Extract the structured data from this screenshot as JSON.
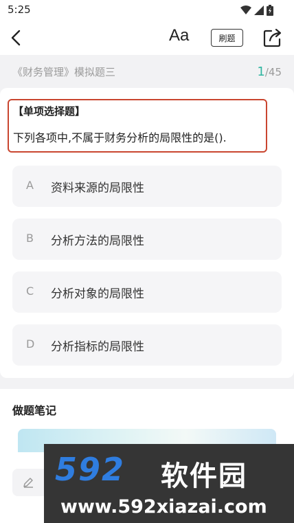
{
  "status_bar": {
    "time": "5:25"
  },
  "toolbar": {
    "font_label": "Aa",
    "drill_label": "刷题"
  },
  "exam": {
    "title": "《财务管理》模拟题三",
    "current": "1",
    "total": "/45"
  },
  "question": {
    "type": "【单项选择题】",
    "text": "下列各项中,不属于财务分析的局限性的是()."
  },
  "options": [
    {
      "letter": "A",
      "text": "资料来源的局限性"
    },
    {
      "letter": "B",
      "text": "分析方法的局限性"
    },
    {
      "letter": "C",
      "text": "分析对象的局限性"
    },
    {
      "letter": "D",
      "text": "分析指标的局限性"
    }
  ],
  "notes": {
    "title": "做题笔记"
  },
  "watermark": {
    "logo": "592",
    "name": "软件园",
    "url": "www.592xiazai.com"
  },
  "colors": {
    "accent": "#2fb5a0",
    "highlight_border": "#c9452f",
    "watermark_blue": "#2f7de0"
  }
}
